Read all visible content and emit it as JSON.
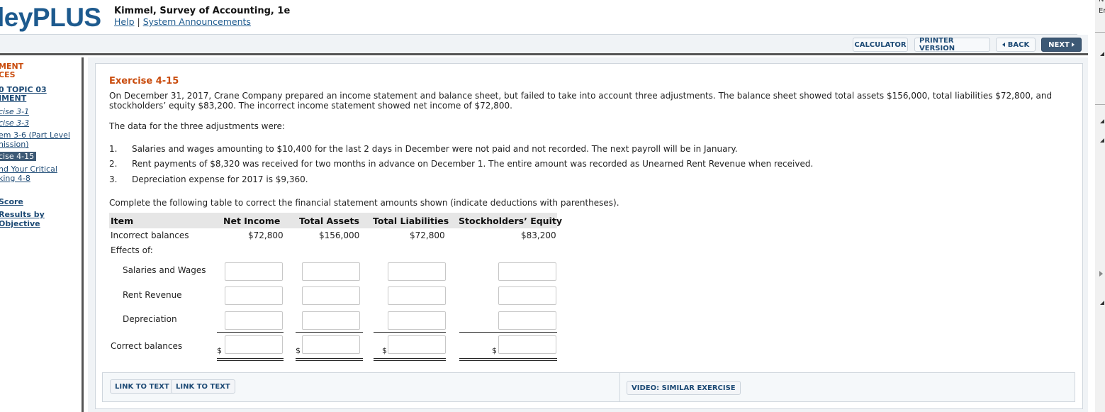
{
  "header": {
    "logo": "leyPLUS",
    "course_title": "Kimmel, Survey of Accounting, 1e",
    "help_link": "Help",
    "separator": "|",
    "announcements_link": "System Announcements"
  },
  "right_edge": {
    "label_top": "N",
    "label_second": "Er"
  },
  "toolbar": {
    "calculator": "CALCULATOR",
    "printer_version": "PRINTER VERSION",
    "back": "BACK",
    "next": "NEXT"
  },
  "sidebar": {
    "items": [
      {
        "label": "MENT",
        "type": "head"
      },
      {
        "label": "CES",
        "type": "head"
      },
      {
        "label": "0 TOPIC 03",
        "type": "link"
      },
      {
        "label": "IMENT",
        "type": "link"
      },
      {
        "label": "cise 3-1",
        "type": "ilink"
      },
      {
        "label": "cise 3-3",
        "type": "ilink"
      },
      {
        "label": "em 3-6 (Part Level",
        "type": "plink"
      },
      {
        "label": "nission)",
        "type": "plink"
      },
      {
        "label": "cise 4-15",
        "type": "active"
      },
      {
        "label": "nd Your Critical",
        "type": "plink"
      },
      {
        "label": "king 4-8",
        "type": "plink"
      },
      {
        "label": " Score",
        "type": "link"
      },
      {
        "label": " Results by",
        "type": "link"
      },
      {
        "label": "Objective",
        "type": "link"
      }
    ]
  },
  "exercise": {
    "title": "Exercise 4-15",
    "intro_line1": "On December 31, 2017, Crane Company prepared an income statement and balance sheet, but failed to take into account three adjustments. The balance sheet showed total assets $156,000, total liabilities $72,800, and",
    "intro_line2": "stockholders’ equity $83,200. The incorrect income statement showed net income of $72,800.",
    "data_intro": "The data for the three adjustments were:",
    "adjustments": [
      {
        "num": "1.",
        "text": "Salaries and wages amounting to $10,400 for the last 2 days in December were not paid and not recorded. The next payroll will be in January."
      },
      {
        "num": "2.",
        "text": "Rent payments of $8,320 was received for two months in advance on December 1. The entire amount was recorded as Unearned Rent Revenue when received."
      },
      {
        "num": "3.",
        "text": "Depreciation expense for 2017 is $9,360."
      }
    ],
    "instructions": "Complete the following table to correct the financial statement amounts shown (indicate deductions with parentheses)."
  },
  "table": {
    "headers": [
      "Item",
      "Net Income",
      "Total Assets",
      "Total Liabilities",
      "Stockholders’ Equity"
    ],
    "incorrect_label": "Incorrect balances",
    "incorrect_values": [
      "$72,800",
      "$156,000",
      "$72,800",
      "$83,200"
    ],
    "effects_label": "Effects of:",
    "effect_rows": [
      {
        "label": "Salaries and Wages",
        "values": [
          "",
          "",
          "",
          ""
        ]
      },
      {
        "label": "Rent Revenue",
        "values": [
          "",
          "",
          "",
          ""
        ]
      },
      {
        "label": "Depreciation",
        "values": [
          "",
          "",
          "",
          ""
        ]
      }
    ],
    "correct_label": "Correct balances",
    "currency_symbol": "$",
    "correct_values": [
      "",
      "",
      "",
      ""
    ]
  },
  "bottom": {
    "link_to_text_1": "LINK TO TEXT",
    "link_to_text_2": "LINK TO TEXT",
    "video": "VIDEO: SIMILAR EXERCISE"
  }
}
